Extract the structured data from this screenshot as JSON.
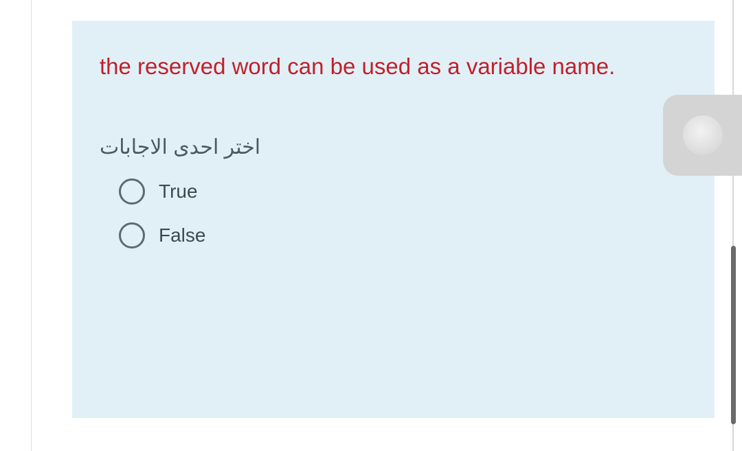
{
  "question": {
    "text": "the reserved word can be used as a variable name.",
    "prompt": "اختر احدى الاجابات",
    "options": [
      {
        "label": "True"
      },
      {
        "label": "False"
      }
    ]
  }
}
